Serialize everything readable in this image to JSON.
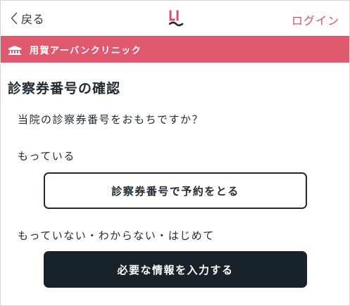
{
  "header": {
    "back_label": "戻る",
    "login_label": "ログイン",
    "logo_icon": "clinic-logo-icon",
    "accent_color": "#d9506a"
  },
  "clinic_bar": {
    "name": "用賀アーバンクリニック",
    "icon": "clinic-building-icon",
    "background_color": "#df5a6f"
  },
  "main": {
    "title": "診察券番号の確認",
    "question": "当院の診察券番号をおもちですか？",
    "have_label": "もっている",
    "have_button": "診察券番号で予約をとる",
    "not_have_label": "もっていない・わからない・はじめて",
    "not_have_button": "必要な情報を入力する"
  }
}
